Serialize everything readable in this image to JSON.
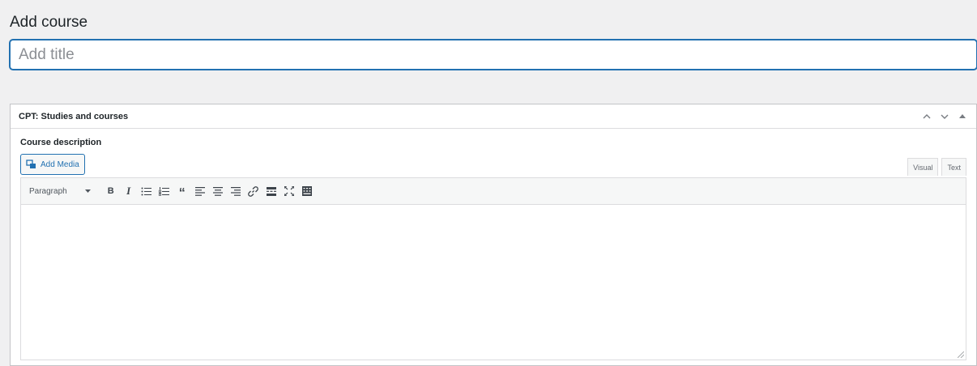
{
  "page": {
    "title": "Add course"
  },
  "title_field": {
    "placeholder": "Add title",
    "value": ""
  },
  "metabox": {
    "title": "CPT: Studies and courses",
    "field_label": "Course description",
    "add_media_label": "Add Media",
    "tabs": [
      {
        "label": "Visual"
      },
      {
        "label": "Text"
      }
    ],
    "format_select": {
      "selected": "Paragraph"
    },
    "toolbar_buttons": [
      {
        "name": "bold",
        "glyph": "B"
      },
      {
        "name": "italic",
        "glyph": "I"
      },
      {
        "name": "bulleted-list",
        "icon": "bulleted-list-icon"
      },
      {
        "name": "numbered-list",
        "icon": "numbered-list-icon"
      },
      {
        "name": "blockquote",
        "glyph": "“"
      },
      {
        "name": "align-left",
        "icon": "align-left-icon"
      },
      {
        "name": "align-center",
        "icon": "align-center-icon"
      },
      {
        "name": "align-right",
        "icon": "align-right-icon"
      },
      {
        "name": "insert-link",
        "icon": "link-icon"
      },
      {
        "name": "insert-read-more",
        "icon": "read-more-icon"
      },
      {
        "name": "fullscreen",
        "icon": "fullscreen-icon"
      },
      {
        "name": "toolbar-toggle",
        "icon": "kitchen-sink-icon"
      }
    ],
    "content": ""
  },
  "colors": {
    "accent": "#2271b1",
    "background": "#f0f0f1",
    "border": "#c3c4c7"
  }
}
